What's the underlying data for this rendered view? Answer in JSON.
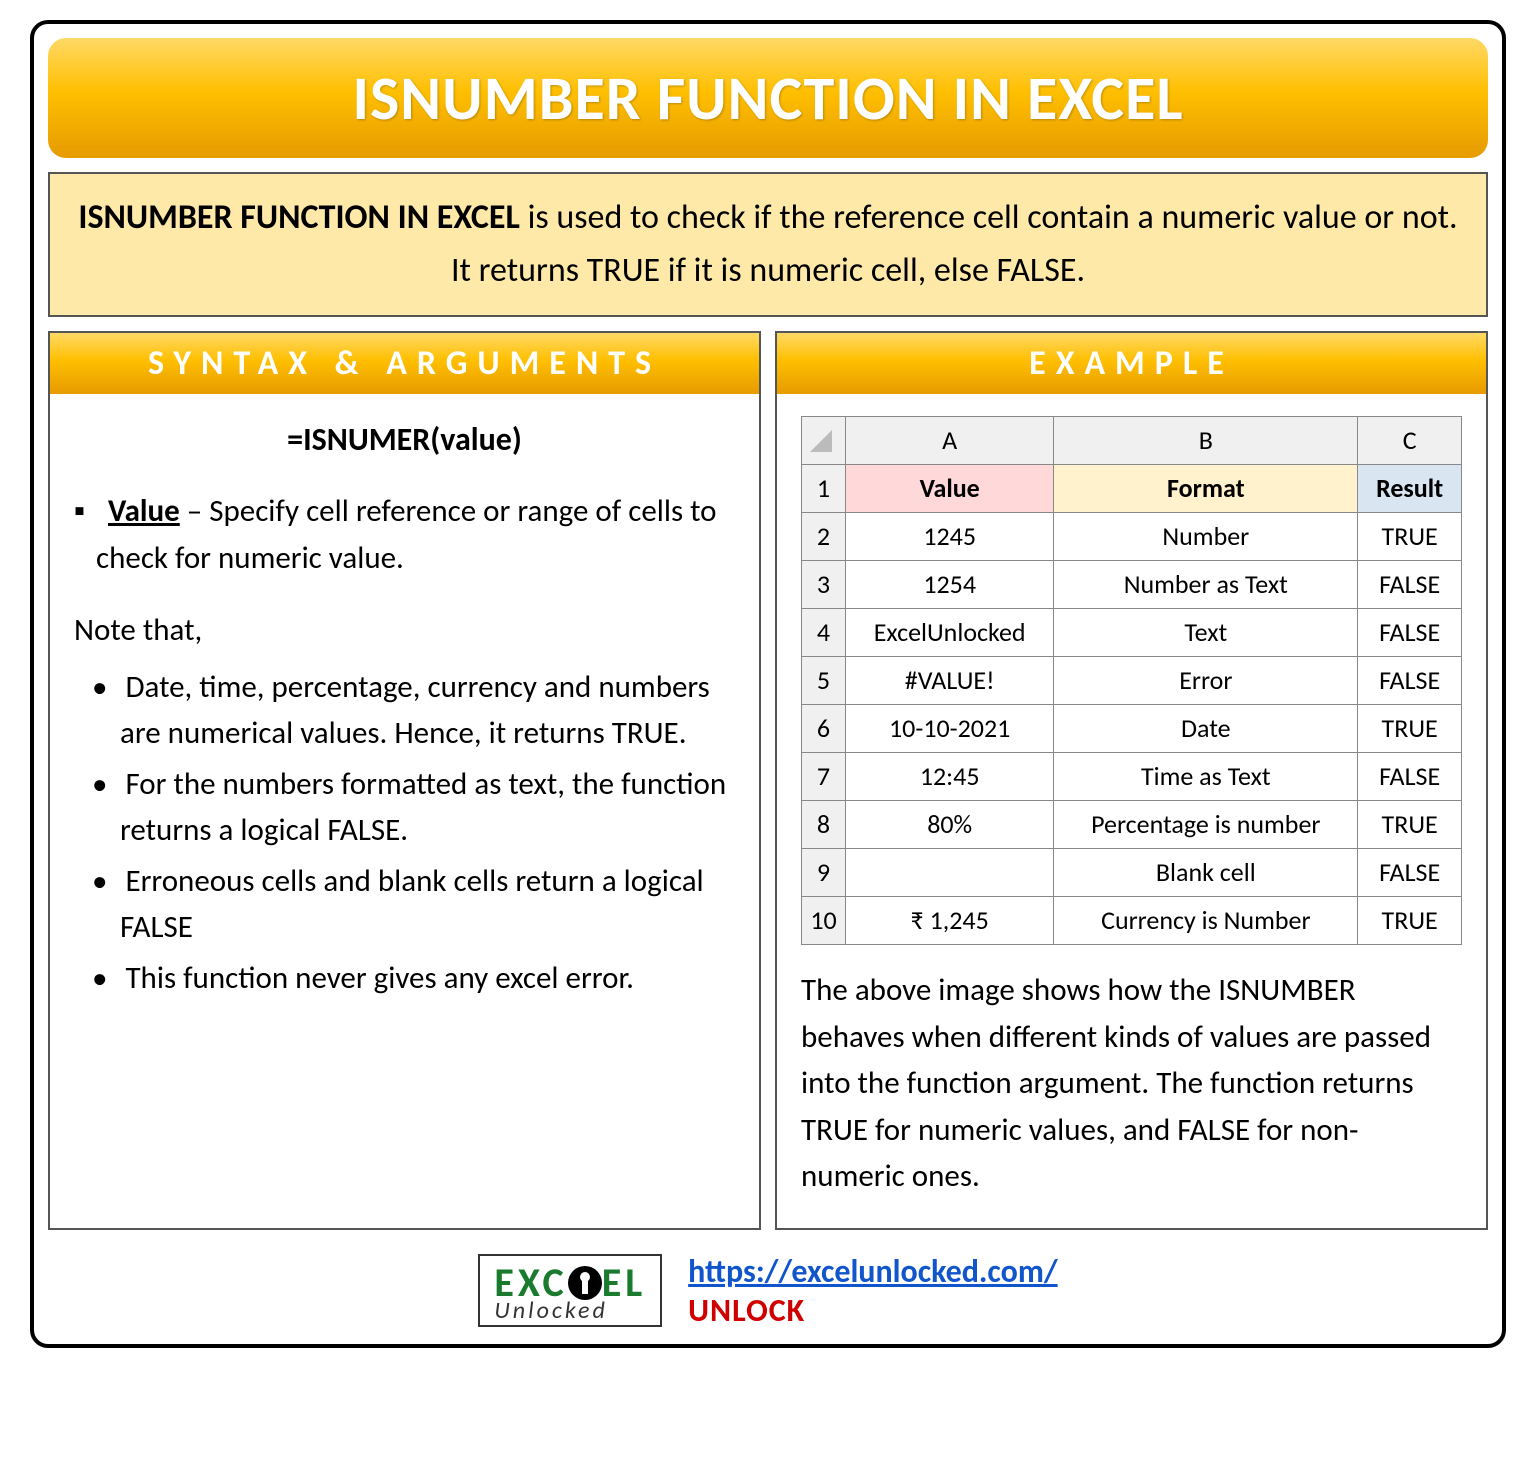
{
  "title": "ISNUMBER FUNCTION IN EXCEL",
  "description": {
    "bold": "ISNUMBER FUNCTION IN EXCEL",
    "rest": " is used to check if the reference cell contain a numeric value or not. It returns TRUE if it is numeric cell, else FALSE."
  },
  "syntax_panel": {
    "heading": "SYNTAX & ARGUMENTS",
    "formula": "=ISNUMER(value)",
    "arg_name": "Value",
    "arg_desc": " – Specify cell reference or range of cells to check for numeric value.",
    "note_label": "Note that,",
    "notes": [
      "Date, time, percentage, currency and numbers are numerical values. Hence, it returns TRUE.",
      "For the numbers formatted as text, the function returns a logical FALSE.",
      "Erroneous cells and blank cells return a logical FALSE",
      "This function never gives any excel error."
    ]
  },
  "example_panel": {
    "heading": "EXAMPLE",
    "col_letters": [
      "A",
      "B",
      "C"
    ],
    "headers": [
      "Value",
      "Format",
      "Result"
    ],
    "rows": [
      {
        "n": "2",
        "a": "1245",
        "b": "Number",
        "c": "TRUE"
      },
      {
        "n": "3",
        "a": "1254",
        "b": "Number as Text",
        "c": "FALSE"
      },
      {
        "n": "4",
        "a": "ExcelUnlocked",
        "b": "Text",
        "c": "FALSE"
      },
      {
        "n": "5",
        "a": "#VALUE!",
        "b": "Error",
        "c": "FALSE"
      },
      {
        "n": "6",
        "a": "10-10-2021",
        "b": "Date",
        "c": "TRUE"
      },
      {
        "n": "7",
        "a": "12:45",
        "b": "Time as Text",
        "c": "FALSE"
      },
      {
        "n": "8",
        "a": "80%",
        "b": "Percentage is number",
        "c": "TRUE"
      },
      {
        "n": "9",
        "a": "",
        "b": "Blank cell",
        "c": "FALSE"
      },
      {
        "n": "10",
        "a": "₹ 1,245",
        "b": "Currency is Number",
        "c": "TRUE"
      }
    ],
    "caption": "The above image shows how the ISNUMBER behaves when different kinds of values are passed into the function argument. The function returns TRUE for numeric values, and FALSE for non-numeric ones."
  },
  "footer": {
    "logo_top_left": "EXC",
    "logo_top_right": "EL",
    "logo_bottom": "Unlocked",
    "url": "https://excelunlocked.com/",
    "unlock": "UNLOCK"
  }
}
